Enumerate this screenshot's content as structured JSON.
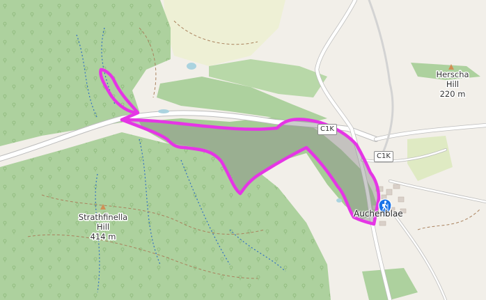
{
  "map": {
    "colors": {
      "background": "#f2efe9",
      "forest": "#add19e",
      "farmland": "#eef0d5",
      "route": "#e535e5",
      "route_fill": "#8c8c8c",
      "marker": "#1a73e8"
    },
    "hills": [
      {
        "name": "Herscha",
        "line2": "Hill",
        "elevation": "220 m"
      },
      {
        "name": "Strathfinella",
        "line2": "Hill",
        "elevation": "414 m"
      }
    ],
    "village": {
      "name": "Auchenblae"
    },
    "road_refs": [
      {
        "ref": "C1K"
      },
      {
        "ref": "C1K"
      }
    ],
    "marker": {
      "icon": "hiker-icon"
    }
  }
}
